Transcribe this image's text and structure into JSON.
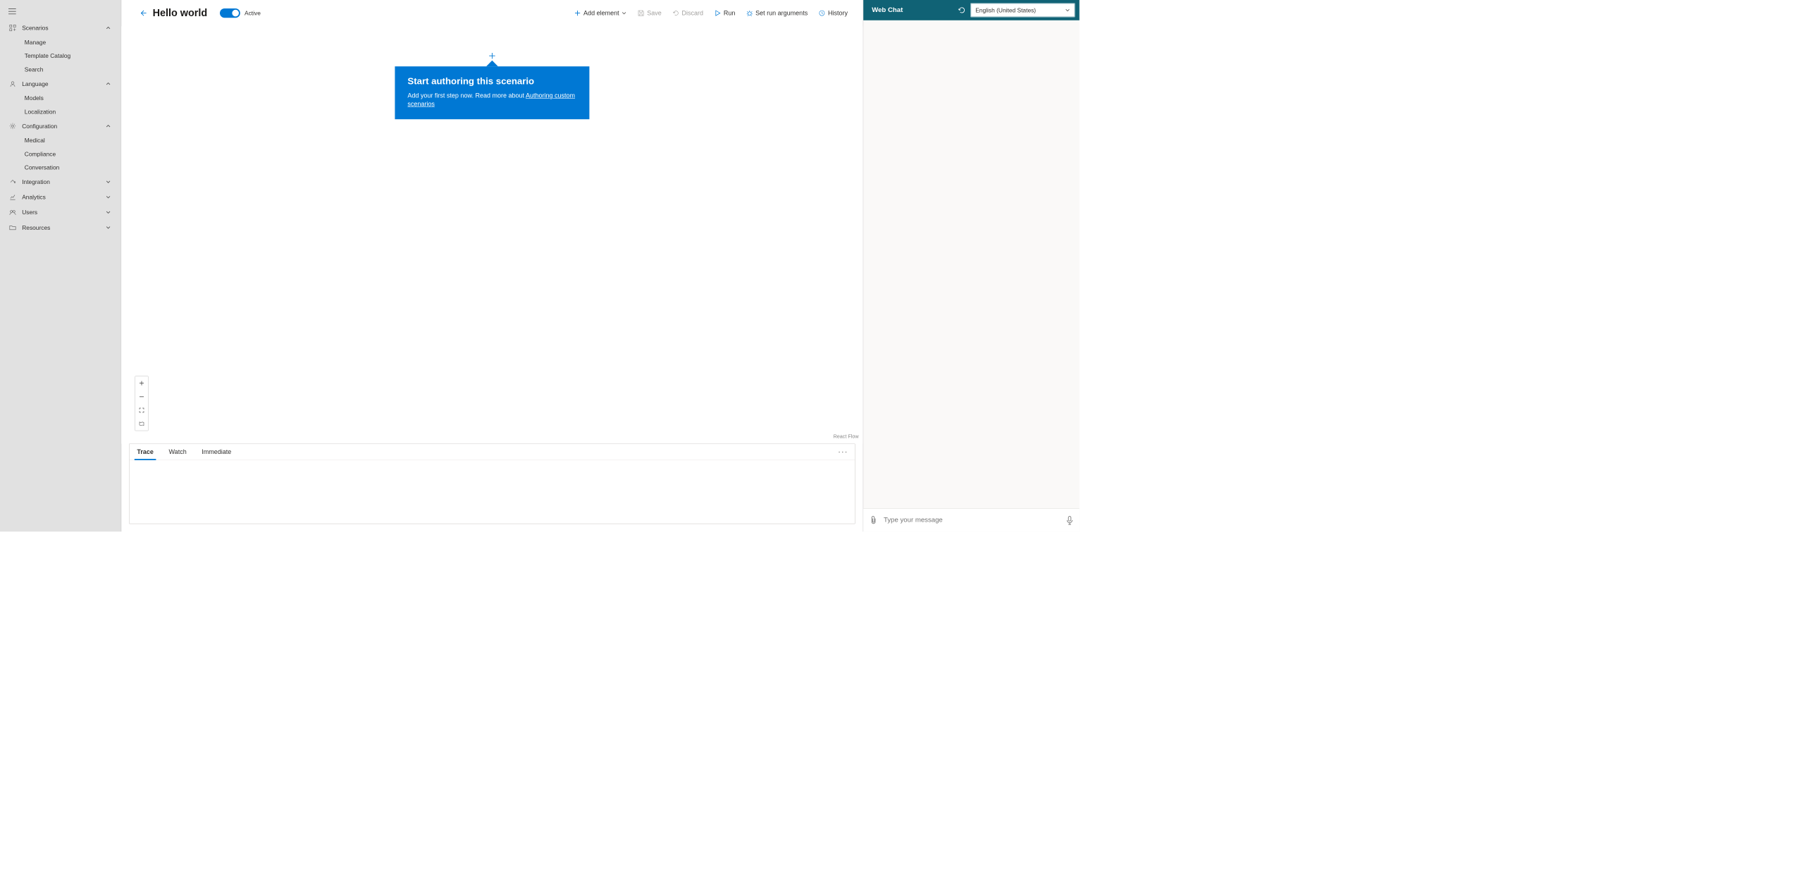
{
  "sidebar": {
    "groups": [
      {
        "label": "Scenarios",
        "expanded": true,
        "items": [
          "Manage",
          "Template Catalog",
          "Search"
        ]
      },
      {
        "label": "Language",
        "expanded": true,
        "items": [
          "Models",
          "Localization"
        ]
      },
      {
        "label": "Configuration",
        "expanded": true,
        "items": [
          "Medical",
          "Compliance",
          "Conversation"
        ]
      },
      {
        "label": "Integration",
        "expanded": false,
        "items": []
      },
      {
        "label": "Analytics",
        "expanded": false,
        "items": []
      },
      {
        "label": "Users",
        "expanded": false,
        "items": []
      },
      {
        "label": "Resources",
        "expanded": false,
        "items": []
      }
    ]
  },
  "header": {
    "title": "Hello world",
    "toggle_label": "Active",
    "actions": {
      "add_element": "Add element",
      "save": "Save",
      "discard": "Discard",
      "run": "Run",
      "set_run_args": "Set run arguments",
      "history": "History"
    }
  },
  "canvas": {
    "callout_title": "Start authoring this scenario",
    "callout_body": "Add your first step now. Read more about ",
    "callout_link": "Authoring custom scenarios",
    "attribution": "React Flow"
  },
  "bottom": {
    "tabs": [
      "Trace",
      "Watch",
      "Immediate"
    ],
    "active_tab": 0
  },
  "webchat": {
    "title": "Web Chat",
    "language": "English (United States)",
    "input_placeholder": "Type your message"
  }
}
